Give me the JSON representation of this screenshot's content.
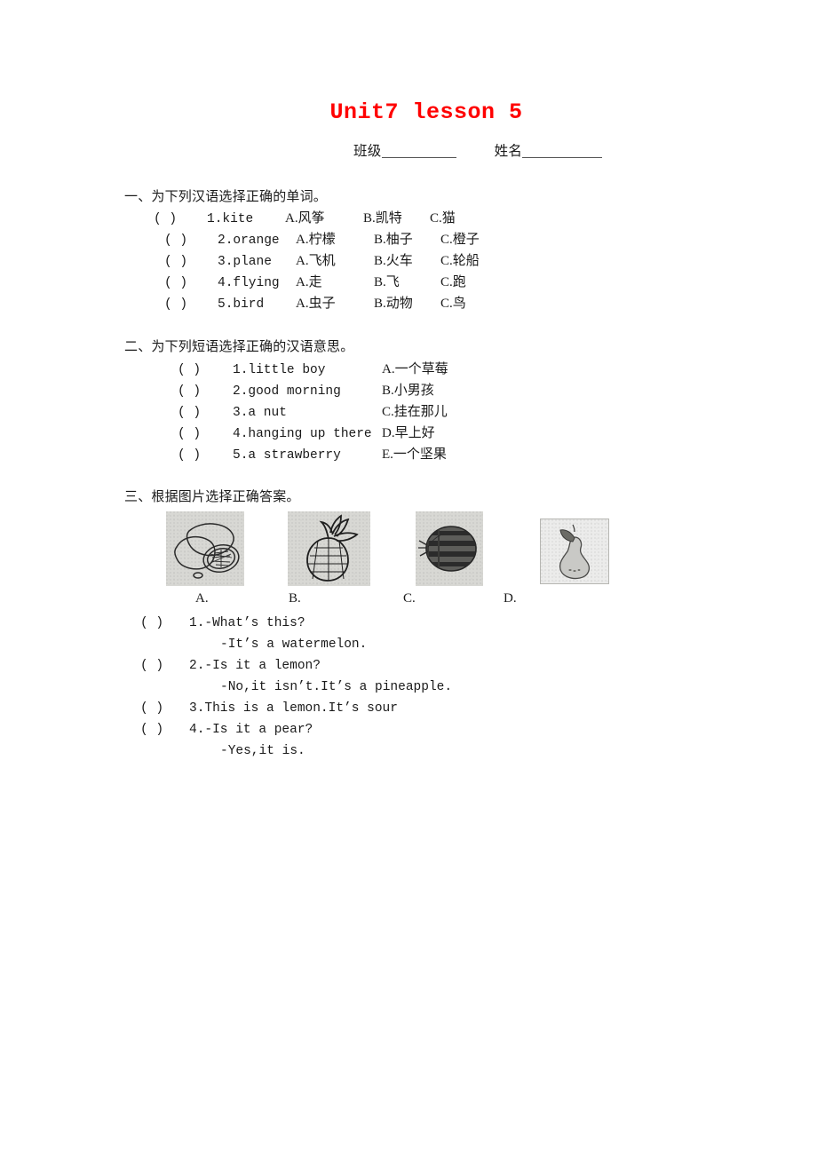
{
  "document": {
    "title": "Unit7 lesson 5",
    "title_color": "#ff0000",
    "header": {
      "class_label": "班级",
      "name_label": "姓名"
    }
  },
  "sections": [
    {
      "heading": "一、为下列汉语选择正确的单词。",
      "items": [
        {
          "paren": "(        )",
          "num": "1.kite",
          "a": "A.风筝",
          "b": "B.凯特",
          "c": "C.猫"
        },
        {
          "paren": "(        )",
          "num": "2.orange",
          "a": "A.柠檬",
          "b": "B.柚子",
          "c": "C.橙子"
        },
        {
          "paren": "(        )",
          "num": "3.plane",
          "a": "A.飞机",
          "b": "B.火车",
          "c": "C.轮船"
        },
        {
          "paren": "(        )",
          "num": "4.flying",
          "a": "A.走",
          "b": "B.飞",
          "c": "C.跑"
        },
        {
          "paren": "(        )",
          "num": "5.bird",
          "a": "A.虫子",
          "b": "B.动物",
          "c": "C.鸟"
        }
      ]
    },
    {
      "heading": "二、为下列短语选择正确的汉语意思。",
      "items": [
        {
          "paren": "(        )",
          "num": "1.little boy",
          "ans": "A.一个草莓"
        },
        {
          "paren": "(        )",
          "num": "2.good morning",
          "ans": "B.小男孩"
        },
        {
          "paren": "(        )",
          "num": "3.a nut",
          "ans": "C.挂在那儿"
        },
        {
          "paren": "(        )",
          "num": "4.hanging up there",
          "ans": "D.早上好"
        },
        {
          "paren": "(        )",
          "num": "5.a strawberry",
          "ans": "E.一个坚果"
        }
      ]
    },
    {
      "heading": "三、根据图片选择正确答案。",
      "pictures": [
        {
          "label": "A.",
          "icon": "lemon-icon"
        },
        {
          "label": "B.",
          "icon": "pineapple-icon"
        },
        {
          "label": "C.",
          "icon": "watermelon-icon"
        },
        {
          "label": "D.",
          "icon": "pear-icon"
        }
      ],
      "items": [
        {
          "paren": "(     )",
          "line1": "1.-What’s this?",
          "line2": "-It’s a watermelon."
        },
        {
          "paren": "(     )",
          "line1": "2.-Is it a lemon?",
          "line2": "-No,it isn’t.It’s a pineapple."
        },
        {
          "paren": "(     )",
          "line1": "3.This is a lemon.It’s sour",
          "line2": ""
        },
        {
          "paren": "(     )",
          "line1": "4.-Is it a pear?",
          "line2": "-Yes,it is."
        }
      ]
    }
  ]
}
